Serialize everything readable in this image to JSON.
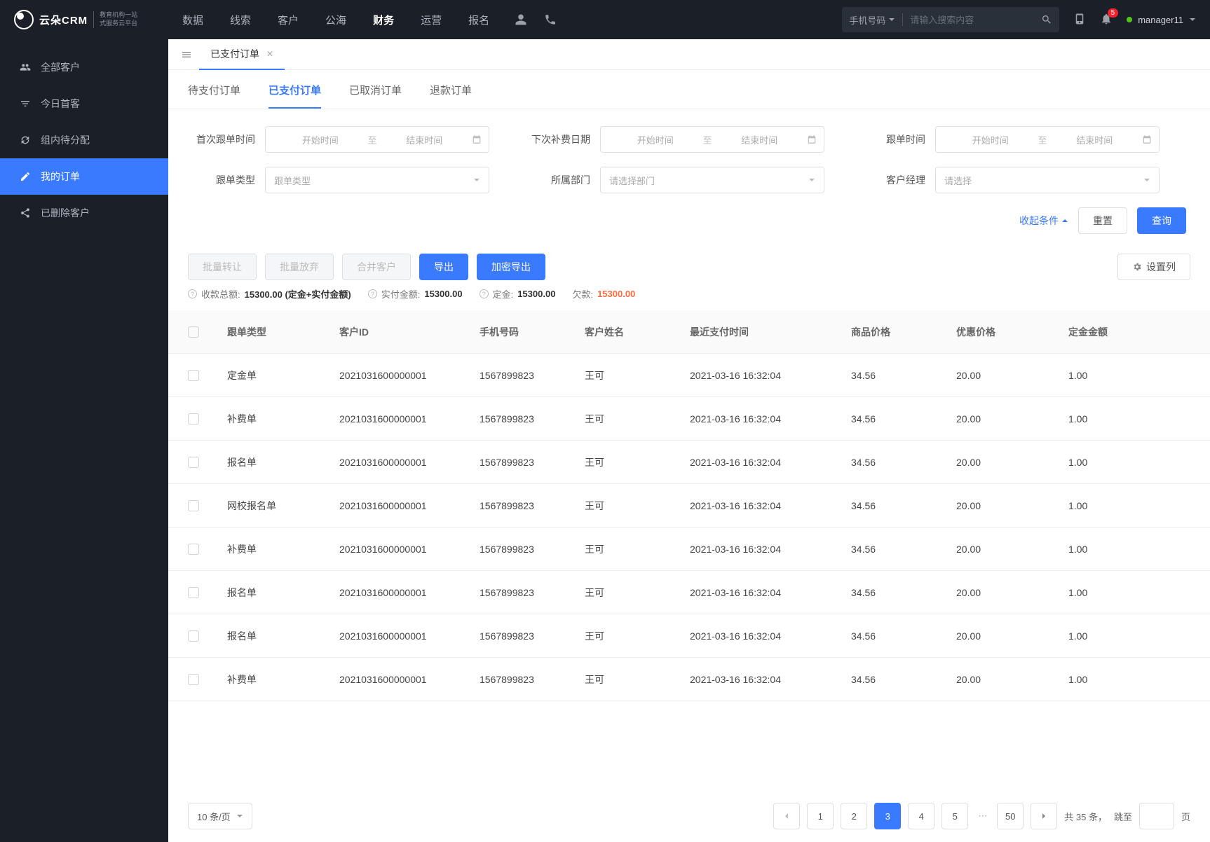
{
  "brand": {
    "name": "云朵CRM",
    "sub1": "教育机构一站",
    "sub2": "式服务云平台"
  },
  "topnav": [
    "数据",
    "线索",
    "客户",
    "公海",
    "财务",
    "运营",
    "报名"
  ],
  "topnav_active": 4,
  "search": {
    "type_label": "手机号码",
    "placeholder": "请输入搜索内容"
  },
  "notif_count": "5",
  "user": "manager11",
  "sidebar": {
    "items": [
      {
        "label": "全部客户",
        "icon": "users"
      },
      {
        "label": "今日首客",
        "icon": "filter"
      },
      {
        "label": "组内待分配",
        "icon": "refresh"
      },
      {
        "label": "我的订单",
        "icon": "edit"
      },
      {
        "label": "已删除客户",
        "icon": "share"
      }
    ],
    "active": 3
  },
  "page_tab": "已支付订单",
  "subtabs": [
    "待支付订单",
    "已支付订单",
    "已取消订单",
    "退款订单"
  ],
  "subtab_active": 1,
  "filters": {
    "first_follow": {
      "label": "首次跟单时间",
      "start": "开始时间",
      "mid": "至",
      "end": "结束时间"
    },
    "next_fee": {
      "label": "下次补费日期",
      "start": "开始时间",
      "mid": "至",
      "end": "结束时间"
    },
    "follow_time": {
      "label": "跟单时间",
      "start": "开始时间",
      "mid": "至",
      "end": "结束时间"
    },
    "follow_type": {
      "label": "跟单类型",
      "placeholder": "跟单类型"
    },
    "dept": {
      "label": "所属部门",
      "placeholder": "请选择部门"
    },
    "manager": {
      "label": "客户经理",
      "placeholder": "请选择"
    },
    "collapse": "收起条件",
    "reset": "重置",
    "query": "查询"
  },
  "toolbar": {
    "batch_transfer": "批量转让",
    "batch_abandon": "批量放弃",
    "merge": "合并客户",
    "export": "导出",
    "enc_export": "加密导出",
    "set_cols": "设置列"
  },
  "summary": {
    "total_label": "收款总额:",
    "total_value": "15300.00 (定金+实付金额)",
    "paid_label": "实付金额:",
    "paid_value": "15300.00",
    "deposit_label": "定金:",
    "deposit_value": "15300.00",
    "debt_label": "欠款:",
    "debt_value": "15300.00"
  },
  "table": {
    "headers": [
      "跟单类型",
      "客户ID",
      "手机号码",
      "客户姓名",
      "最近支付时间",
      "商品价格",
      "优惠价格",
      "定金金额"
    ],
    "rows": [
      {
        "type": "定金单",
        "cid": "2021031600000001",
        "phone": "1567899823",
        "name": "王可",
        "time": "2021-03-16 16:32:04",
        "price": "34.56",
        "discount": "20.00",
        "deposit": "1.00"
      },
      {
        "type": "补费单",
        "cid": "2021031600000001",
        "phone": "1567899823",
        "name": "王可",
        "time": "2021-03-16 16:32:04",
        "price": "34.56",
        "discount": "20.00",
        "deposit": "1.00"
      },
      {
        "type": "报名单",
        "cid": "2021031600000001",
        "phone": "1567899823",
        "name": "王可",
        "time": "2021-03-16 16:32:04",
        "price": "34.56",
        "discount": "20.00",
        "deposit": "1.00"
      },
      {
        "type": "网校报名单",
        "cid": "2021031600000001",
        "phone": "1567899823",
        "name": "王可",
        "time": "2021-03-16 16:32:04",
        "price": "34.56",
        "discount": "20.00",
        "deposit": "1.00"
      },
      {
        "type": "补费单",
        "cid": "2021031600000001",
        "phone": "1567899823",
        "name": "王可",
        "time": "2021-03-16 16:32:04",
        "price": "34.56",
        "discount": "20.00",
        "deposit": "1.00"
      },
      {
        "type": "报名单",
        "cid": "2021031600000001",
        "phone": "1567899823",
        "name": "王可",
        "time": "2021-03-16 16:32:04",
        "price": "34.56",
        "discount": "20.00",
        "deposit": "1.00"
      },
      {
        "type": "报名单",
        "cid": "2021031600000001",
        "phone": "1567899823",
        "name": "王可",
        "time": "2021-03-16 16:32:04",
        "price": "34.56",
        "discount": "20.00",
        "deposit": "1.00"
      },
      {
        "type": "补费单",
        "cid": "2021031600000001",
        "phone": "1567899823",
        "name": "王可",
        "time": "2021-03-16 16:32:04",
        "price": "34.56",
        "discount": "20.00",
        "deposit": "1.00"
      }
    ]
  },
  "pager": {
    "size_label": "10 条/页",
    "pages": [
      "1",
      "2",
      "3",
      "4",
      "5"
    ],
    "active": 2,
    "last": "50",
    "total_prefix": "共",
    "total_count": "35",
    "total_suffix": "条，",
    "jump_label": "跳至",
    "jump_suffix": "页"
  }
}
